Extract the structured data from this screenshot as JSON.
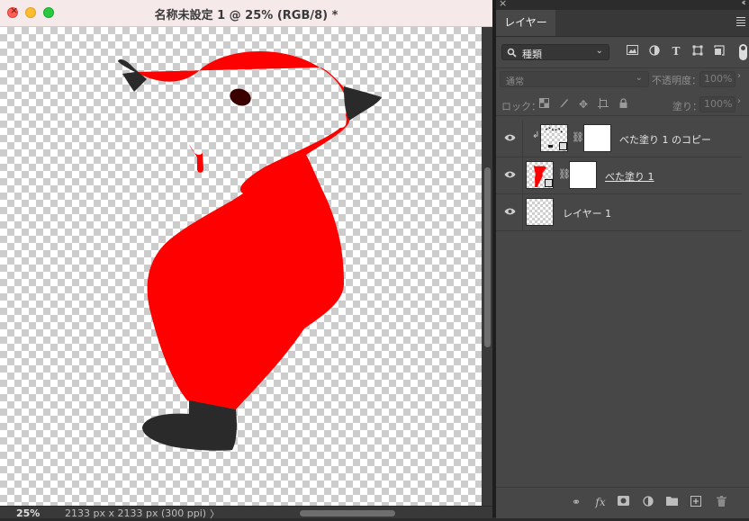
{
  "document": {
    "title": "名称未設定 1 @ 25% (RGB/8) *",
    "zoom": "25%",
    "doc_size": "2133 px x 2133 px (300 ppi)",
    "status_arrow": "〉",
    "fill_color": "#ff0000",
    "boot_color": "#2a2a2a"
  },
  "panel": {
    "tab_label": "レイヤー",
    "filter_kind": "種類",
    "blend_mode": "通常",
    "opacity_label": "不透明度：",
    "opacity_value": "100%",
    "lock_label": "ロック：",
    "fill_label": "塗り：",
    "fill_value": "100%",
    "layers": [
      {
        "name": "べた塗り 1 のコピー",
        "clipped": true,
        "visible": true
      },
      {
        "name": "べた塗り 1",
        "clipped": false,
        "visible": true
      },
      {
        "name": "レイヤー 1",
        "clipped": false,
        "visible": true
      }
    ]
  },
  "icons": {
    "filter_icons": [
      "image-filter-icon",
      "adjustment-filter-icon",
      "type-filter-icon",
      "shape-filter-icon",
      "smart-object-filter-icon"
    ],
    "lock_icons": [
      "lock-transparent-icon",
      "lock-image-icon",
      "lock-position-icon",
      "lock-artboard-icon",
      "lock-all-icon"
    ],
    "footer_icons": [
      "link-layers-icon",
      "fx-icon",
      "add-mask-icon",
      "new-adjustment-icon",
      "new-group-icon",
      "new-layer-icon",
      "delete-layer-icon"
    ]
  }
}
